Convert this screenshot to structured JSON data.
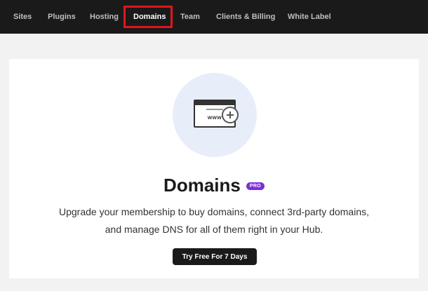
{
  "nav": {
    "items": [
      {
        "label": "Sites"
      },
      {
        "label": "Plugins"
      },
      {
        "label": "Hosting"
      },
      {
        "label": "Domains",
        "active": true
      },
      {
        "label": "Team"
      },
      {
        "label": "Clients & Billing"
      },
      {
        "label": "White Label"
      }
    ]
  },
  "main": {
    "illustration_icon": "browser-www-add-icon",
    "illustration_text": "www",
    "title": "Domains",
    "badge": "PRO",
    "description_line1": "Upgrade your membership to buy domains, connect 3rd-party domains,",
    "description_line2": "and manage DNS for all of them right in your Hub.",
    "cta_label": "Try Free For 7 Days"
  },
  "colors": {
    "nav_bg": "#1a1a1a",
    "highlight": "#e0161c",
    "badge": "#7b2fd6",
    "illustration_bg": "#e7eefa"
  }
}
